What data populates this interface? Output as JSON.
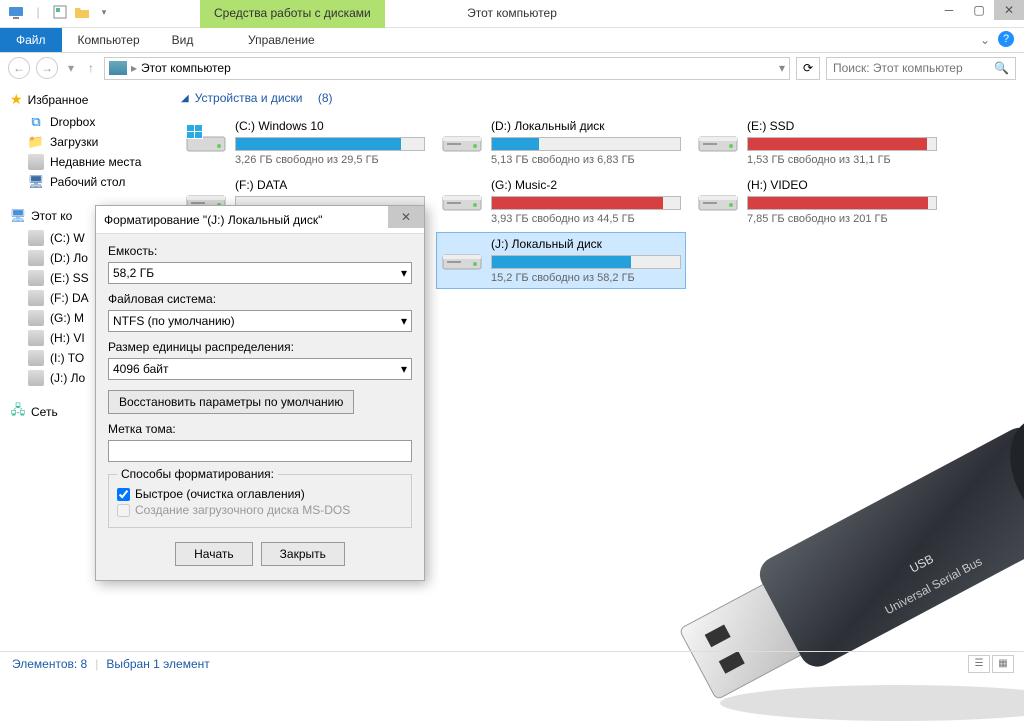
{
  "titlebar": {
    "context_tab": "Средства работы с дисками",
    "title": "Этот компьютер"
  },
  "ribbon": {
    "file": "Файл",
    "computer": "Компьютер",
    "view": "Вид",
    "manage": "Управление"
  },
  "address": {
    "location": "Этот компьютер"
  },
  "search": {
    "placeholder": "Поиск: Этот компьютер"
  },
  "sidebar": {
    "favorites": {
      "label": "Избранное",
      "items": [
        "Dropbox",
        "Загрузки",
        "Недавние места",
        "Рабочий стол"
      ]
    },
    "this_pc": {
      "label": "Этот ко",
      "items": [
        "(C:) W",
        "(D:) Ло",
        "(E:) SS",
        "(F:) DA",
        "(G:) M",
        "(H:) VI",
        "(I:) TO",
        "(J:) Ло"
      ]
    },
    "network": {
      "label": "Сеть"
    }
  },
  "section": {
    "title": "Устройства и диски",
    "count": "(8)"
  },
  "drives": [
    {
      "name": "(C:) Windows 10",
      "free": "3,26 ГБ свободно из 29,5 ГБ",
      "fill": 88,
      "color": "blue",
      "win": true
    },
    {
      "name": "(D:) Локальный диск",
      "free": "5,13 ГБ свободно из 6,83 ГБ",
      "fill": 25,
      "color": "blue"
    },
    {
      "name": "(E:) SSD",
      "free": "1,53 ГБ свободно из 31,1 ГБ",
      "fill": 95,
      "color": "red"
    },
    {
      "name": "(F:) DATA",
      "free": "",
      "fill": 0,
      "color": "blue"
    },
    {
      "name": "(G:) Music-2",
      "free": "3,93 ГБ свободно из 44,5 ГБ",
      "fill": 91,
      "color": "red"
    },
    {
      "name": "(H:) VIDEO",
      "free": "7,85 ГБ свободно из 201 ГБ",
      "fill": 96,
      "color": "red"
    },
    {
      "name": "",
      "free": "",
      "fill": 0,
      "hidden": true
    },
    {
      "name": "(J:) Локальный диск",
      "free": "15,2 ГБ свободно из 58,2 ГБ",
      "fill": 74,
      "color": "blue",
      "selected": true
    }
  ],
  "dialog": {
    "title": "Форматирование \"(J:) Локальный диск\"",
    "capacity_label": "Емкость:",
    "capacity_value": "58,2 ГБ",
    "fs_label": "Файловая система:",
    "fs_value": "NTFS (по умолчанию)",
    "alloc_label": "Размер единицы распределения:",
    "alloc_value": "4096 байт",
    "restore": "Восстановить параметры по умолчанию",
    "volume_label": "Метка тома:",
    "volume_value": "",
    "methods_label": "Способы форматирования:",
    "quick": "Быстрое (очистка оглавления)",
    "msdos": "Создание загрузочного диска MS-DOS",
    "start": "Начать",
    "close": "Закрыть"
  },
  "status": {
    "items": "Элементов: 8",
    "selected": "Выбран 1 элемент"
  },
  "usb": {
    "line1": "USB",
    "line2": "Universal Serial Bus"
  }
}
